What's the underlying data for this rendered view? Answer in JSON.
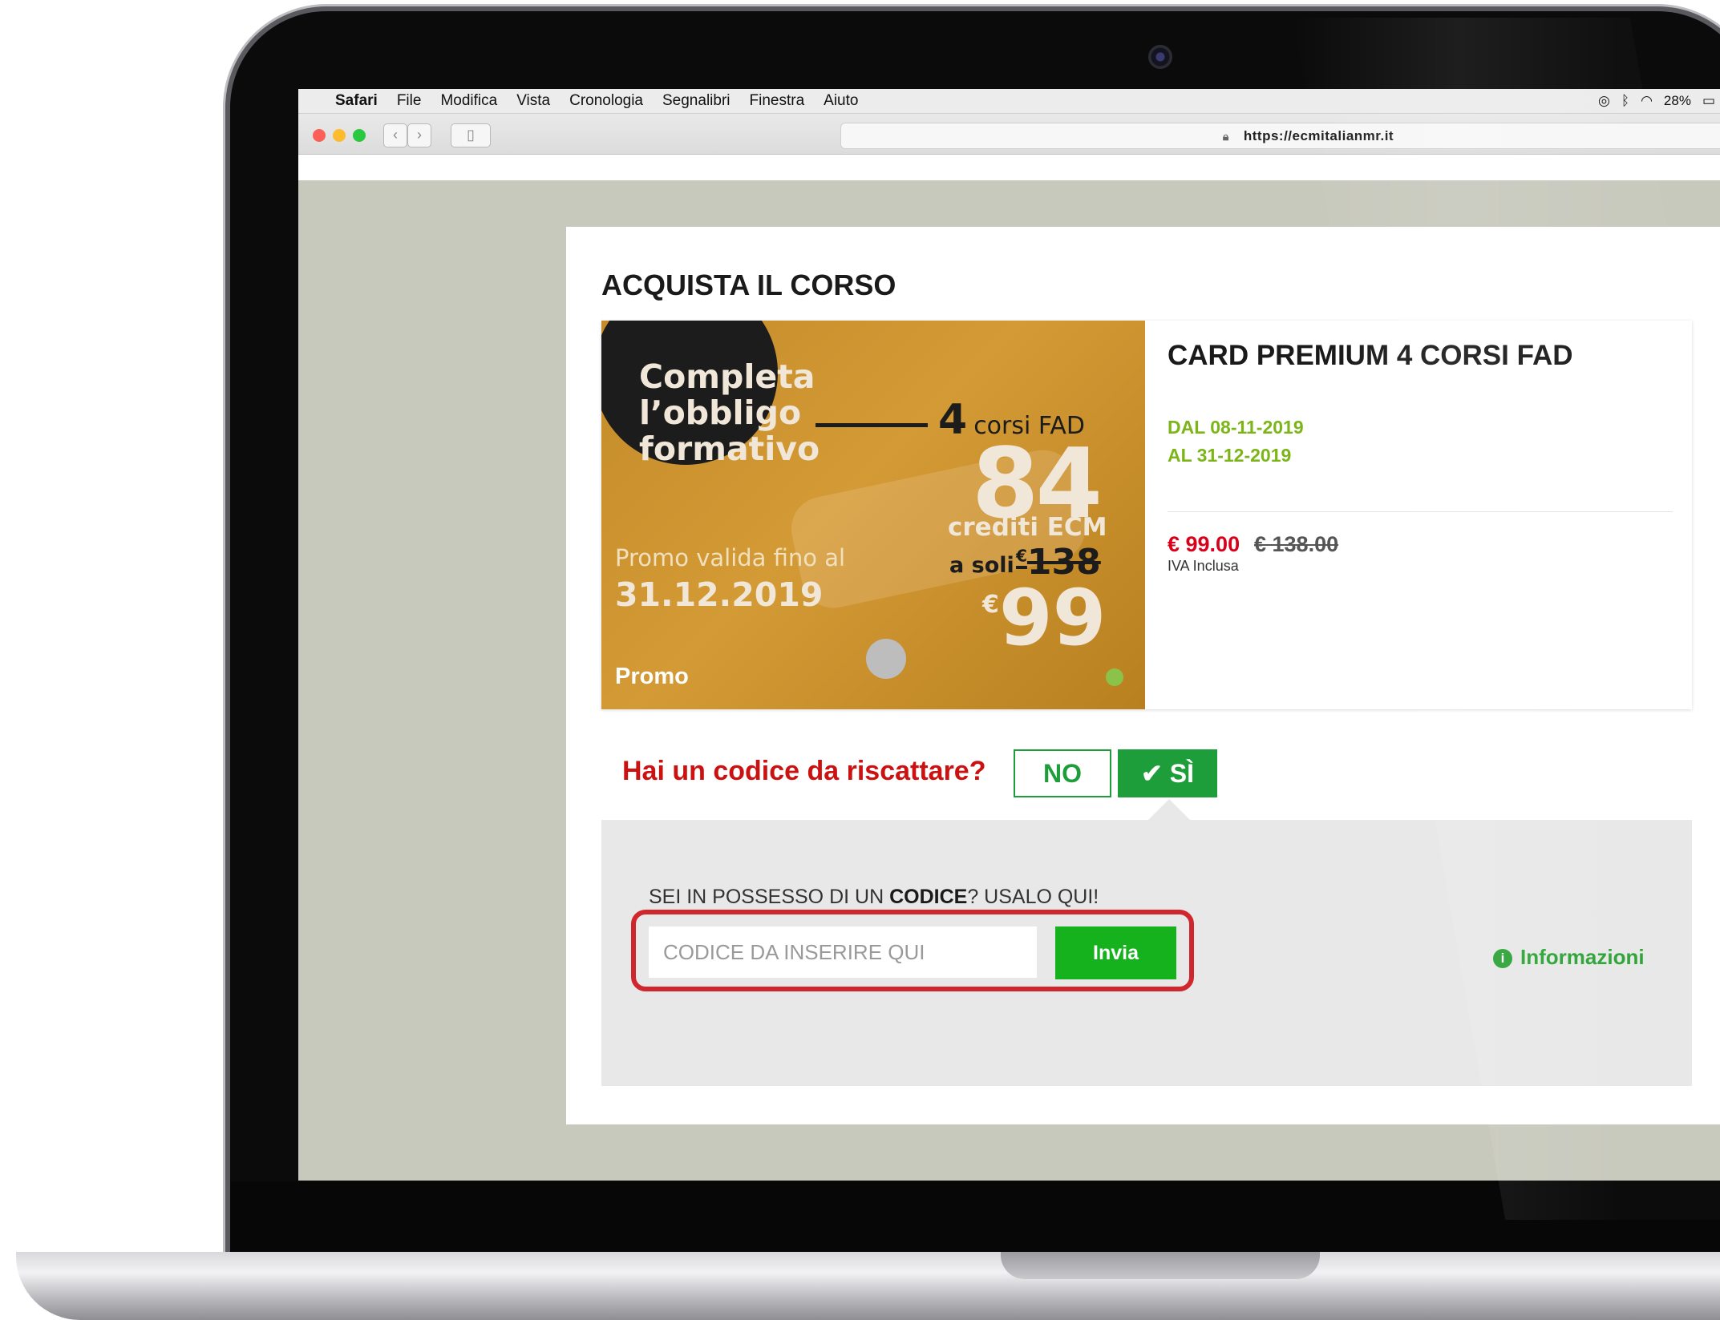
{
  "menubar": {
    "app": "Safari",
    "items": [
      "File",
      "Modifica",
      "Vista",
      "Cronologia",
      "Segnalibri",
      "Finestra",
      "Aiuto"
    ],
    "battery": "28%"
  },
  "browser": {
    "url": "https://ecmitalianmr.it"
  },
  "page": {
    "title": "ACQUISTA IL CORSO",
    "promo": {
      "headline_1": "Completa",
      "headline_2": "l’obbligo",
      "headline_3": "formativo",
      "count": "4",
      "count_label": "corsi FAD",
      "credits": "84",
      "credits_label": "crediti ECM",
      "a_soli": "a soli",
      "old_currency": "€",
      "old_price": "138",
      "new_currency": "€",
      "new_price": "99",
      "valida": "Promo valida fino al",
      "valida_date": "31.12.2019",
      "tag": "Promo"
    },
    "product": {
      "name": "CARD PREMIUM 4 CORSI FAD",
      "dal": "DAL 08-11-2019",
      "al": "AL 31-12-2019",
      "price": "€ 99.00",
      "old_price": "€ 138.00",
      "iva": "IVA Inclusa"
    },
    "code_question": "Hai un codice da riscattare?",
    "btn_no": "NO",
    "btn_si": "SÌ",
    "code_label_1": "SEI IN POSSESSO DI UN ",
    "code_label_bold": "CODICE",
    "code_label_2": "? USALO QUI!",
    "code_placeholder": "CODICE DA INSERIRE QUI",
    "btn_invia": "Invia",
    "informazioni": "Informazioni"
  },
  "colors": {
    "green": "#1e9e3a",
    "red": "#cc1111",
    "highlight": "#d0272f"
  }
}
